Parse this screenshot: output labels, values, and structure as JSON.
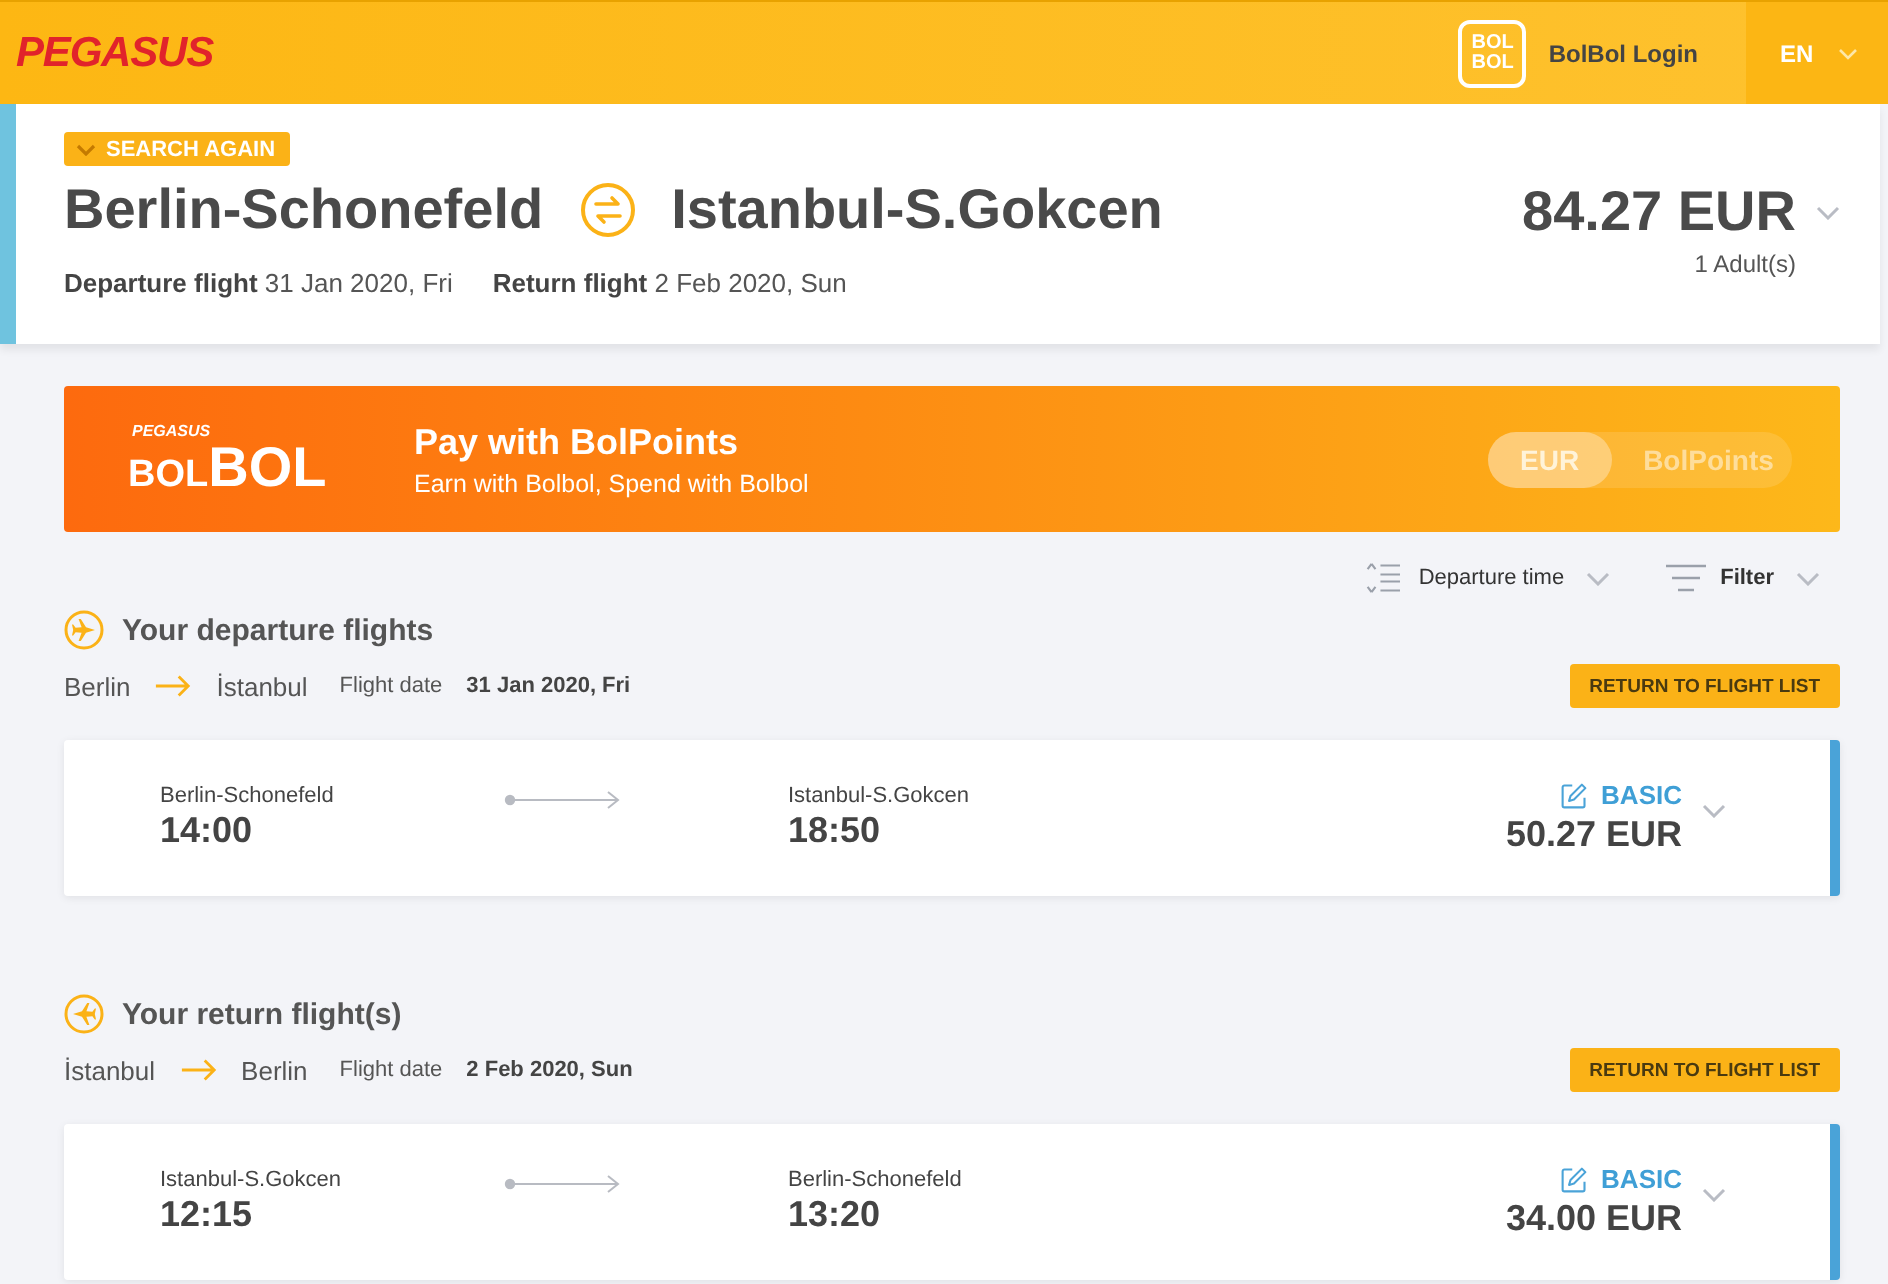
{
  "header": {
    "logo": "PEGASUS",
    "bolbol_badge": [
      "BOL",
      "BOL"
    ],
    "login": "BolBol Login",
    "language": "EN"
  },
  "summary": {
    "search_again": "SEARCH AGAIN",
    "origin": "Berlin-Schonefeld",
    "destination": "Istanbul-S.Gokcen",
    "departure_label": "Departure flight",
    "departure_date": "31 Jan 2020, Fri",
    "return_label": "Return flight",
    "return_date": "2 Feb 2020, Sun",
    "total": "84.27 EUR",
    "passengers": "1 Adult(s)"
  },
  "bolpoints_banner": {
    "logo_small": "PEGASUS",
    "logo": [
      "BOL",
      "BOL"
    ],
    "title": "Pay with BolPoints",
    "subtitle": "Earn with Bolbol, Spend with Bolbol",
    "currency_options": [
      {
        "label": "EUR",
        "selected": true
      },
      {
        "label": "BolPoints",
        "selected": false
      }
    ]
  },
  "sort": {
    "label": "Departure time"
  },
  "filter": {
    "label": "Filter"
  },
  "sections": [
    {
      "kind": "departure",
      "title": "Your departure flights",
      "from": "Berlin",
      "to": "İstanbul",
      "date_label": "Flight date",
      "date": "31 Jan 2020, Fri",
      "return_button": "RETURN TO FLIGHT LIST",
      "flights": [
        {
          "origin": "Berlin-Schonefeld",
          "departure_time": "14:00",
          "destination": "Istanbul-S.Gokcen",
          "arrival_time": "18:50",
          "fare": "BASIC",
          "price": "50.27 EUR"
        }
      ]
    },
    {
      "kind": "return",
      "title": "Your return flight(s)",
      "from": "İstanbul",
      "to": "Berlin",
      "date_label": "Flight date",
      "date": "2 Feb 2020, Sun",
      "return_button": "RETURN TO FLIGHT LIST",
      "flights": [
        {
          "origin": "Istanbul-S.Gokcen",
          "departure_time": "12:15",
          "destination": "Berlin-Schonefeld",
          "arrival_time": "13:20",
          "fare": "BASIC",
          "price": "34.00 EUR"
        }
      ]
    }
  ]
}
